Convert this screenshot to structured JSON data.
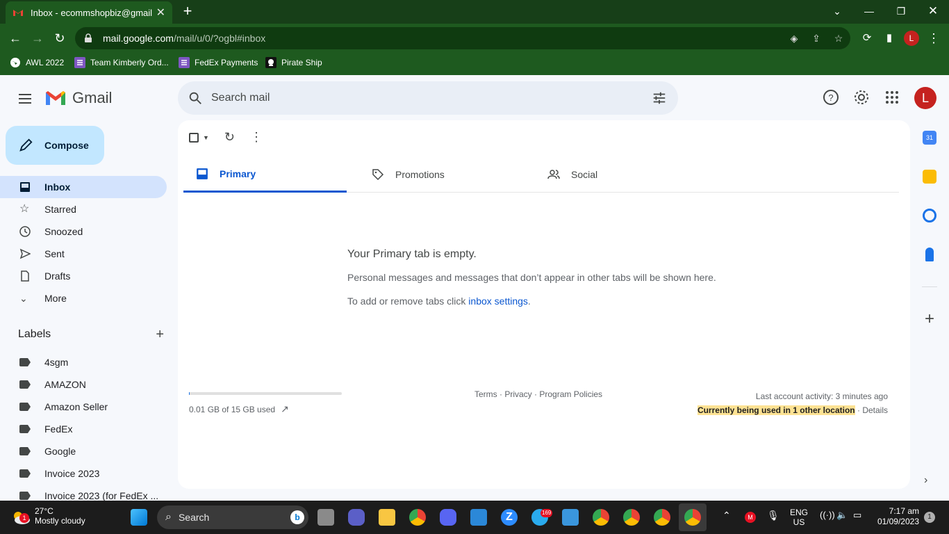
{
  "browser": {
    "tab_title": "Inbox - ecommshopbiz@gmail.com",
    "url_host": "mail.google.com",
    "url_path": "/mail/u/0/?ogbl#inbox",
    "profile_initial": "L",
    "bookmarks": [
      {
        "label": "AWL 2022",
        "icon": "globe-icon"
      },
      {
        "label": "Team Kimberly Ord...",
        "icon": "list-icon"
      },
      {
        "label": "FedEx Payments",
        "icon": "list-icon"
      },
      {
        "label": "Pirate Ship",
        "icon": "pirate-icon"
      }
    ]
  },
  "gmail": {
    "logo_text": "Gmail",
    "search_placeholder": "Search mail",
    "avatar_initial": "L",
    "compose_label": "Compose",
    "nav": [
      {
        "label": "Inbox",
        "icon": "inbox-icon",
        "active": true
      },
      {
        "label": "Starred",
        "icon": "star-icon"
      },
      {
        "label": "Snoozed",
        "icon": "clock-icon"
      },
      {
        "label": "Sent",
        "icon": "send-icon"
      },
      {
        "label": "Drafts",
        "icon": "draft-icon"
      },
      {
        "label": "More",
        "icon": "chevron-down-icon"
      }
    ],
    "labels_title": "Labels",
    "labels": [
      "4sgm",
      "AMAZON",
      "Amazon Seller",
      "FedEx",
      "Google",
      "Invoice 2023",
      "Invoice 2023 (for FedEx ..."
    ],
    "tabs": [
      {
        "label": "Primary",
        "icon": "inbox-tab-icon",
        "active": true
      },
      {
        "label": "Promotions",
        "icon": "tag-icon"
      },
      {
        "label": "Social",
        "icon": "people-icon"
      }
    ],
    "empty": {
      "title": "Your Primary tab is empty.",
      "line1": "Personal messages and messages that don’t appear in other tabs will be shown here.",
      "line2_prefix": "To add or remove tabs click ",
      "line2_link": "inbox settings",
      "line2_suffix": "."
    },
    "footer": {
      "storage_text": "0.01 GB of 15 GB used",
      "storage_fraction": 0.0007,
      "terms": "Terms",
      "privacy": "Privacy",
      "policies": "Program Policies",
      "activity": "Last account activity: 3 minutes ago",
      "other_location": "Currently being used in 1 other location",
      "details": "Details"
    }
  },
  "taskbar": {
    "temp": "27°C",
    "weather": "Mostly cloudy",
    "weather_badge": "1",
    "search_label": "Search",
    "telegram_badge": "169",
    "lang1": "ENG",
    "lang2": "US",
    "time": "7:17 am",
    "date": "01/09/2023",
    "notif_count": "1"
  }
}
